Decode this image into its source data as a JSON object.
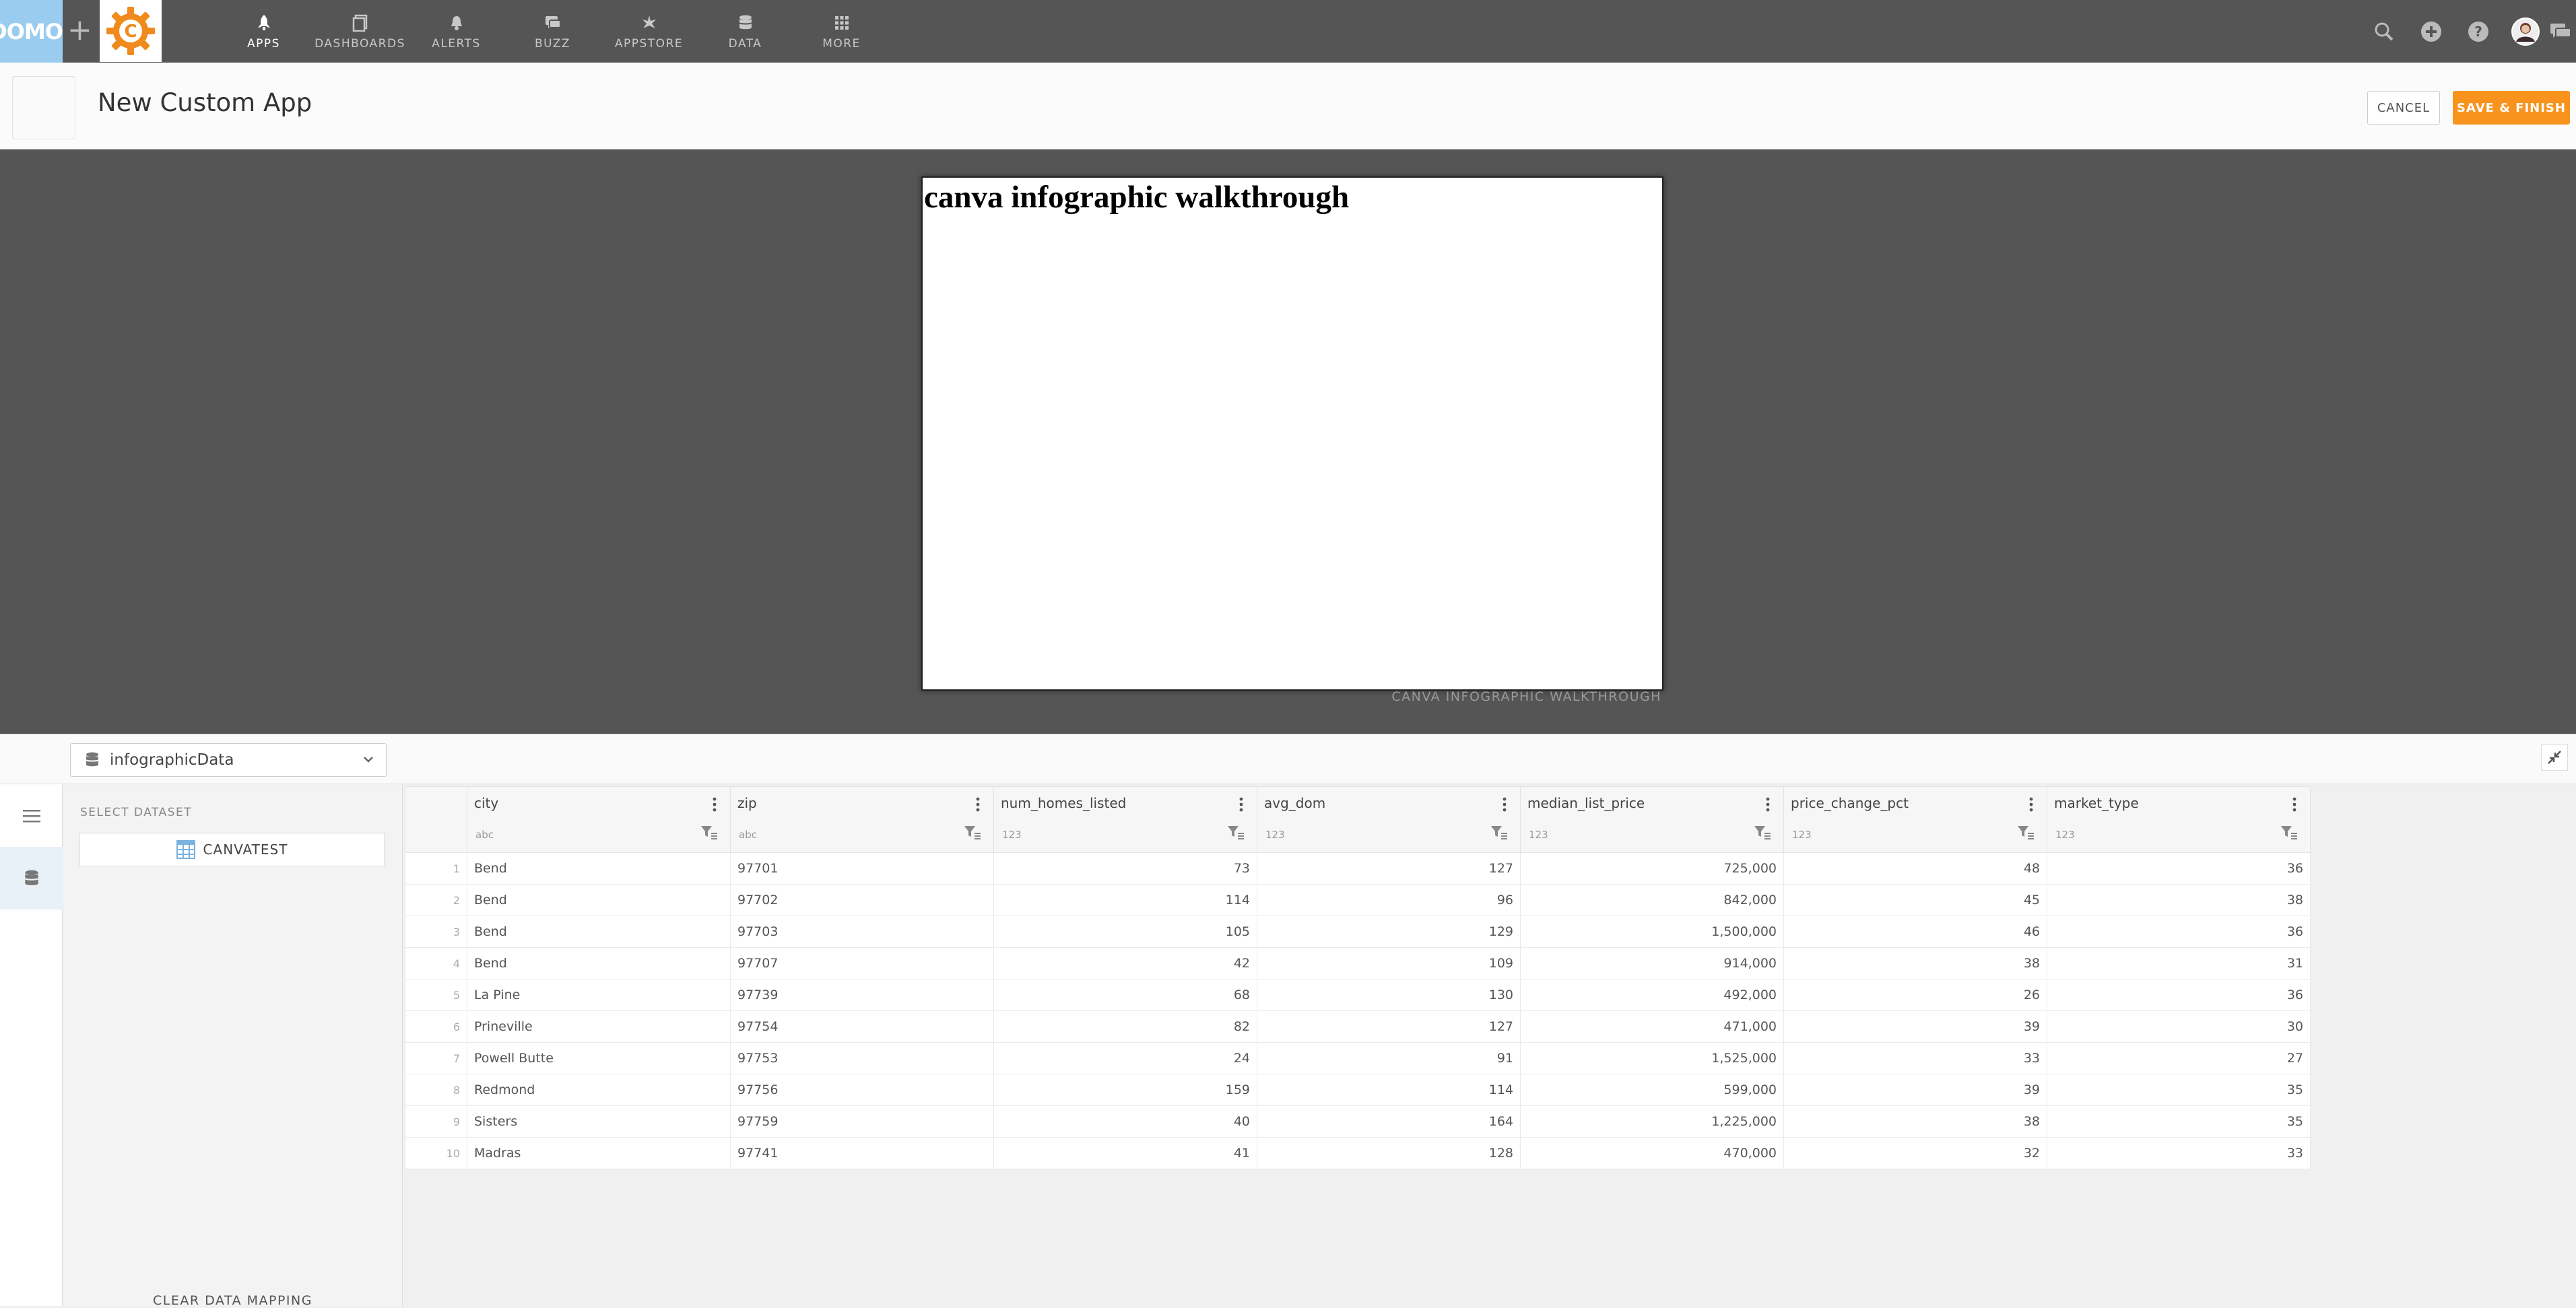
{
  "nav": {
    "logo_text": "DOMO",
    "plus": "+",
    "items": [
      {
        "label": "APPS",
        "icon": "rocket-icon",
        "active": true
      },
      {
        "label": "DASHBOARDS",
        "icon": "dashboards-icon",
        "active": false
      },
      {
        "label": "ALERTS",
        "icon": "bell-icon",
        "active": false
      },
      {
        "label": "BUZZ",
        "icon": "chat-icon",
        "active": false
      },
      {
        "label": "APPSTORE",
        "icon": "appstore-icon",
        "active": false
      },
      {
        "label": "DATA",
        "icon": "database-icon",
        "active": false
      },
      {
        "label": "MORE",
        "icon": "grid-icon",
        "active": false
      }
    ],
    "right_icons": [
      "search-icon",
      "add-icon",
      "help-icon",
      "avatar",
      "chat-icon"
    ]
  },
  "header": {
    "title": "New Custom App",
    "cancel_label": "CANCEL",
    "save_label": "SAVE & FINISH"
  },
  "preview": {
    "heading": "canva infographic walkthrough",
    "caption": "CANVA INFOGRAPHIC WALKTHROUGH"
  },
  "dataset": {
    "selected": "infographicData",
    "select_label": "SELECT DATASET",
    "item": "CANVATEST",
    "clear_label": "CLEAR DATA MAPPING"
  },
  "table": {
    "columns": [
      {
        "name": "city",
        "type": "abc"
      },
      {
        "name": "zip",
        "type": "abc"
      },
      {
        "name": "num_homes_listed",
        "type": "123"
      },
      {
        "name": "avg_dom",
        "type": "123"
      },
      {
        "name": "median_list_price",
        "type": "123"
      },
      {
        "name": "price_change_pct",
        "type": "123"
      },
      {
        "name": "market_type",
        "type": "123"
      }
    ],
    "rows": [
      [
        "1",
        "Bend",
        "97701",
        "73",
        "127",
        "725,000",
        "48",
        "36"
      ],
      [
        "2",
        "Bend",
        "97702",
        "114",
        "96",
        "842,000",
        "45",
        "38"
      ],
      [
        "3",
        "Bend",
        "97703",
        "105",
        "129",
        "1,500,000",
        "46",
        "36"
      ],
      [
        "4",
        "Bend",
        "97707",
        "42",
        "109",
        "914,000",
        "38",
        "31"
      ],
      [
        "5",
        "La Pine",
        "97739",
        "68",
        "130",
        "492,000",
        "26",
        "36"
      ],
      [
        "6",
        "Prineville",
        "97754",
        "82",
        "127",
        "471,000",
        "39",
        "30"
      ],
      [
        "7",
        "Powell Butte",
        "97753",
        "24",
        "91",
        "1,525,000",
        "33",
        "27"
      ],
      [
        "8",
        "Redmond",
        "97756",
        "159",
        "114",
        "599,000",
        "39",
        "35"
      ],
      [
        "9",
        "Sisters",
        "97759",
        "40",
        "164",
        "1,225,000",
        "38",
        "35"
      ],
      [
        "10",
        "Madras",
        "97741",
        "41",
        "128",
        "470,000",
        "32",
        "33"
      ]
    ]
  },
  "colors": {
    "nav_bg": "#555555",
    "accent": "#f8931d",
    "logo_bg": "#99ccee"
  }
}
